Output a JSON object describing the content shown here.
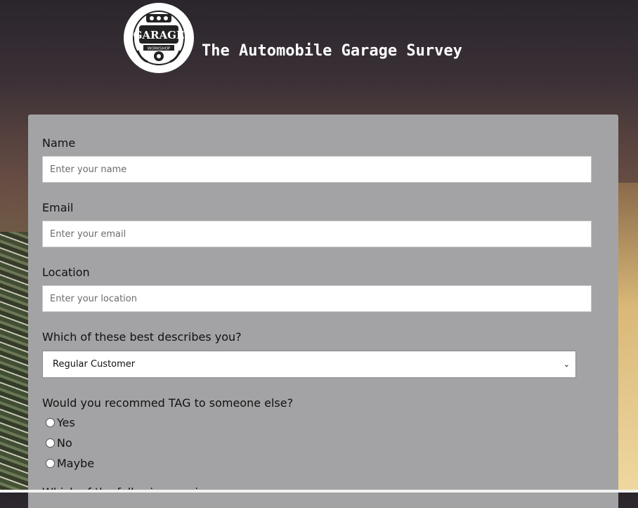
{
  "header": {
    "logo_text": "GARAGE",
    "logo_subtext": "WORKSHOP",
    "title": "The Automobile Garage Survey"
  },
  "form": {
    "name": {
      "label": "Name",
      "placeholder": "Enter your name",
      "value": ""
    },
    "email": {
      "label": "Email",
      "placeholder": "Enter your email",
      "value": ""
    },
    "location": {
      "label": "Location",
      "placeholder": "Enter your location",
      "value": ""
    },
    "role": {
      "label": "Which of these best describes you?",
      "selected": "Regular Customer"
    },
    "recommend": {
      "label": "Would you recommed TAG to someone else?",
      "options": [
        "Yes",
        "No",
        "Maybe"
      ],
      "selected": null
    },
    "next_question_partial": "Which of the following services..."
  },
  "colors": {
    "panel": "#a3a3a5",
    "title": "#ffffff"
  }
}
